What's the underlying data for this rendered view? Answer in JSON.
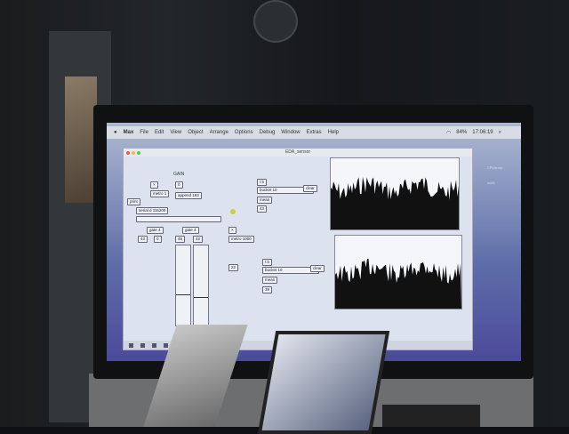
{
  "menubar": {
    "items": [
      "Max",
      "File",
      "Edit",
      "View",
      "Object",
      "Arrange",
      "Options",
      "Debug",
      "Window",
      "Extras",
      "Help"
    ],
    "battery": "84%",
    "time": "17:06:19"
  },
  "window": {
    "title": "EDA_sensor"
  },
  "patch": {
    "gain_label": "GAIN",
    "metro1": "metro 1",
    "num_gain": "0",
    "append": "append 193",
    "print": "print",
    "serial": "serial d 115200",
    "gate_a": "gate 4",
    "gate_b": "gate 4",
    "num_a": "43",
    "num_b": "0",
    "num_c": "45",
    "num_d": "42",
    "metro2": "metro 1000",
    "num_e": "22",
    "top": {
      "trigger": "t b",
      "bucket": "bucket 10",
      "clear": "clear",
      "mean": "mean",
      "value": "43"
    },
    "bottom": {
      "trigger": "t b",
      "bucket": "bucket 10",
      "clear": "clear",
      "mean": "mean",
      "value": "39"
    }
  },
  "sidebar": {
    "items": [
      "CPUtemp",
      "work"
    ]
  },
  "colors": {
    "accent": "#c8d040",
    "plot_fill": "#111111"
  }
}
